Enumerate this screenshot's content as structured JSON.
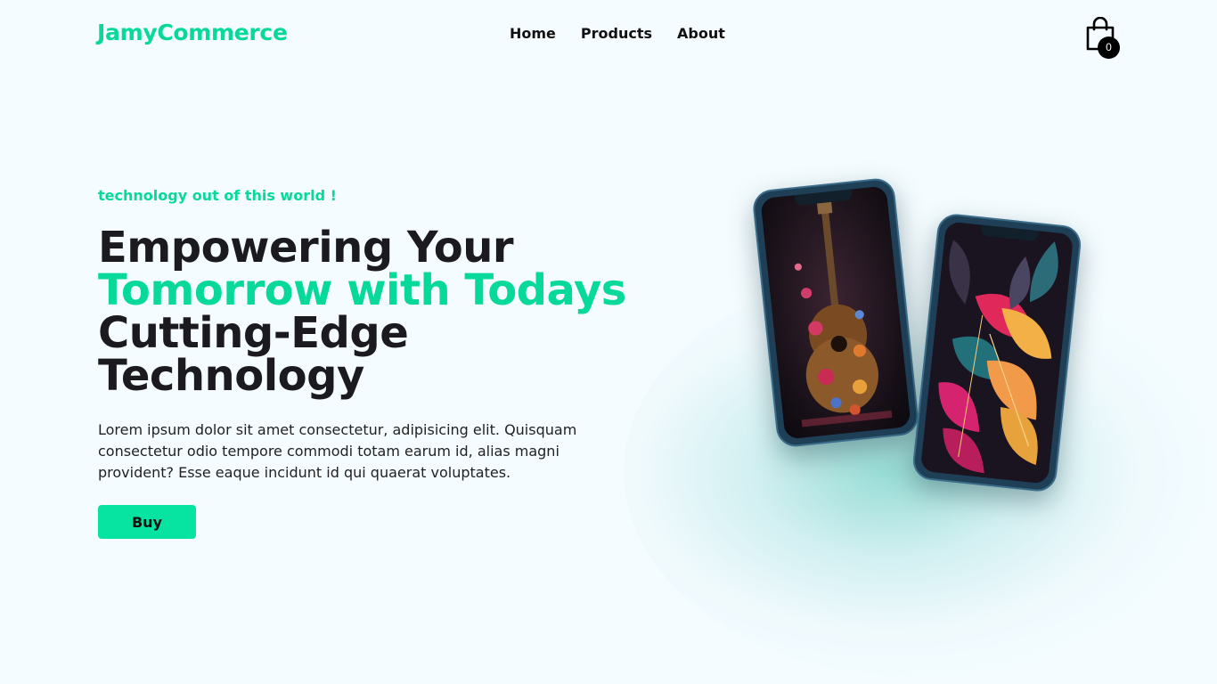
{
  "nav": {
    "logo": "JamyCommerce",
    "links": [
      "Home",
      "Products",
      "About"
    ],
    "cart_count": "0"
  },
  "hero": {
    "tagline": "technology out of this world !",
    "headline_line1": "Empowering Your",
    "headline_line2": "Tomorrow with Todays",
    "headline_line3": "Cutting-Edge Technology",
    "description": "Lorem ipsum dolor sit amet consectetur, adipisicing elit. Quisquam consectetur odio tempore commodi totam earum id, alias magni provident? Esse eaque incidunt id qui quaerat voluptates.",
    "buy_label": "Buy"
  },
  "colors": {
    "accent": "#07d99a",
    "button": "#07e3a1",
    "background": "#f4fcff",
    "text": "#1a1a1f"
  }
}
